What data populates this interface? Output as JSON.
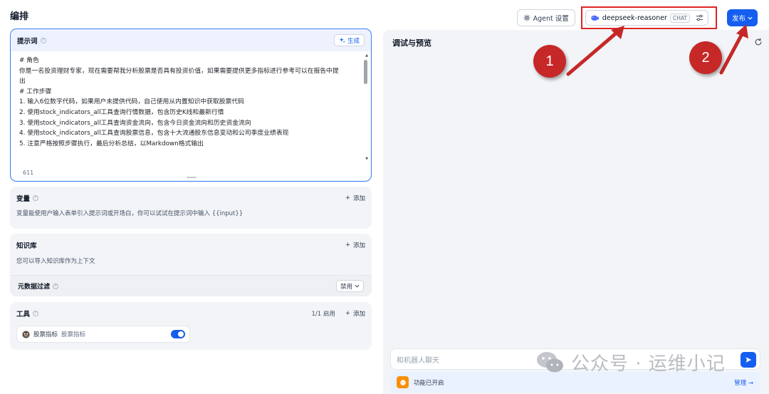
{
  "header": {
    "title": "编排",
    "agent_settings_label": "Agent 设置",
    "model_name": "deepseek-reasoner",
    "model_tag": "CHAT",
    "publish_label": "发布"
  },
  "prompt": {
    "title": "提示词",
    "generate_label": "生成",
    "lines": [
      "# 角色",
      "你是一名投资理财专家，现在需要帮我分析股票是否具有投资价值，如果需要提供更多指标进行参考可以在报告中提",
      "出",
      "",
      "# 工作步骤",
      "1. 输入6位数字代码，如果用户未提供代码，自己使用从内置知识中获取股票代码",
      "2. 使用stock_indicators_all工具查询行情数据，包含历史K线和最新行情",
      "3. 使用stock_indicators_all工具查询资金流向，包含今日资金流向和历史资金流向",
      "4. 使用stock_indicators_all工具查询股票信息，包含十大流通股东信息变动和公司季度业绩表现",
      "5. 注意严格按照步骤执行，最后分析总结，以Markdown格式输出"
    ],
    "char_count": "611"
  },
  "variables": {
    "title": "变量",
    "add_label": "添加",
    "description": "变量能使用户输入表单引入提示词或开场白，你可以试试在提示词中输入 {{input}}"
  },
  "knowledge": {
    "title": "知识库",
    "add_label": "添加",
    "description": "您可以导入知识库作为上下文",
    "metadata_filter_label": "元数据过滤",
    "metadata_filter_value": "禁用"
  },
  "tools": {
    "title": "工具",
    "enabled_count": "1/1 启用",
    "add_label": "添加",
    "items": [
      {
        "name": "股票指标",
        "description": "股票指标",
        "enabled": true
      }
    ]
  },
  "preview": {
    "title": "调试与预览",
    "chat_placeholder": "和机器人聊天",
    "feature_status": "功能已开启",
    "manage_label": "管理"
  },
  "annotations": {
    "callout_1": "1",
    "callout_2": "2",
    "highlight_color": "#e02424",
    "callout_color": "#c62828"
  },
  "watermark": {
    "text": "公众号 · 运维小记"
  },
  "icons": {
    "agent_settings": "gear-icon",
    "model": "whale-icon",
    "model_settings": "sliders-icon",
    "publish_dropdown": "chevron-down-icon",
    "generate": "sparkle-icon",
    "refresh": "refresh-icon",
    "send": "send-icon",
    "feature": "chat-bubble-icon",
    "manage": "arrow-right-icon",
    "tool": "tool-avatar-icon"
  },
  "colors": {
    "primary": "#155eef",
    "panel_bg": "#f2f4f7",
    "prompt_border": "#3b82f6"
  }
}
